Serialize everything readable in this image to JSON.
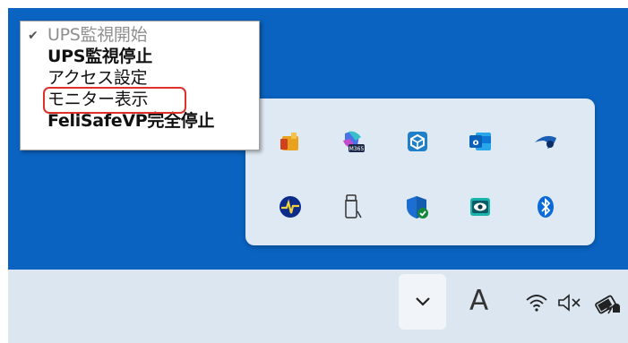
{
  "context_menu": {
    "items": [
      {
        "label": "UPS監視開始",
        "checked": true,
        "enabled": false,
        "bold": false
      },
      {
        "label": "UPS監視停止",
        "checked": false,
        "enabled": true,
        "bold": true
      },
      {
        "label": "アクセス設定",
        "checked": false,
        "enabled": true,
        "bold": false
      },
      {
        "label": "モニター表示",
        "checked": false,
        "enabled": true,
        "bold": false,
        "highlighted": true
      },
      {
        "label": "FeliSafeVP完全停止",
        "checked": false,
        "enabled": true,
        "bold": true
      }
    ]
  },
  "tray_overflow": {
    "row1": [
      "app-orange-folder-icon",
      "copilot-m365-icon",
      "package-app-icon",
      "outlook-icon",
      "blue-swoosh-icon"
    ],
    "row2": [
      "ups-monitor-icon",
      "usb-drive-icon",
      "windows-security-icon",
      "eye-app-icon",
      "bluetooth-icon"
    ]
  },
  "taskbar": {
    "ime_label": "A",
    "m365_badge": "M365",
    "colors": {
      "desktop": "#0a63c0",
      "taskbar": "#dbe6f1",
      "highlight": "#e0302a"
    }
  }
}
